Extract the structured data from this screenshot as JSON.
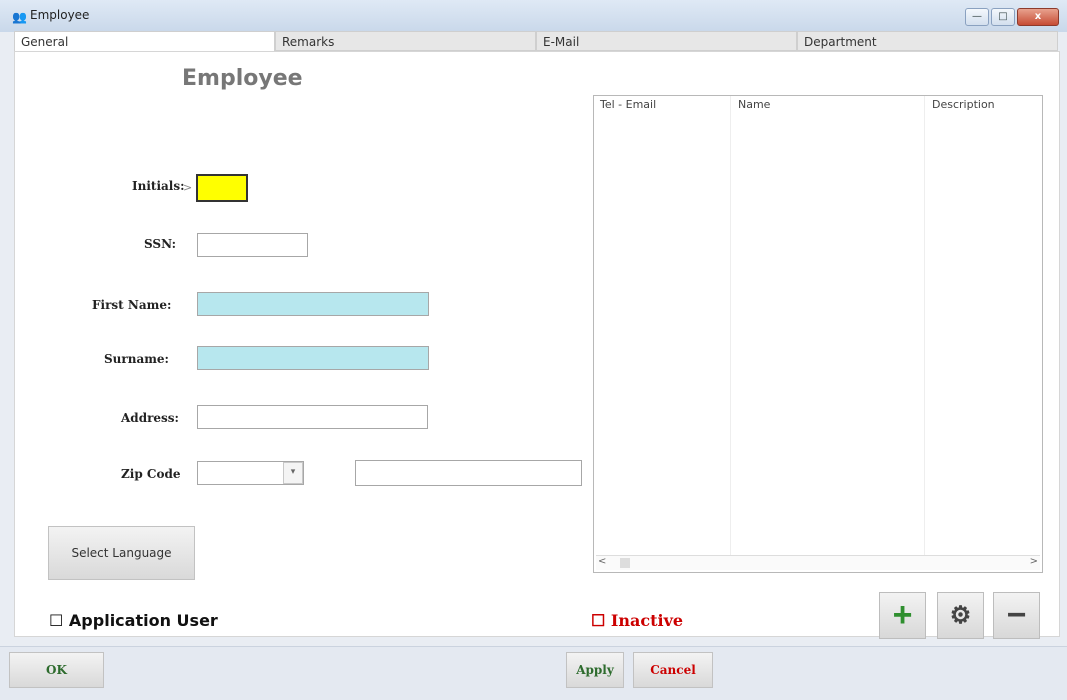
{
  "window": {
    "title": "Employee"
  },
  "tabs": [
    {
      "label": "General"
    },
    {
      "label": "Remarks"
    },
    {
      "label": "E-Mail"
    },
    {
      "label": "Department"
    }
  ],
  "form": {
    "heading": "Employee",
    "fields": {
      "initials": {
        "label": "Initials:",
        "arrow": ">"
      },
      "ssn": {
        "label": "SSN:"
      },
      "first_name": {
        "label": "First Name:"
      },
      "surname": {
        "label": "Surname:"
      },
      "address": {
        "label": "Address:"
      },
      "zip_code": {
        "label": "Zip Code"
      }
    },
    "select_language_button": "Select Language",
    "application_user_label": "Application User"
  },
  "contacts": {
    "columns": [
      "Tel - Email",
      "Name",
      "Description"
    ],
    "scroll_left": "<",
    "scroll_right": ">",
    "inactive_label": "Inactive"
  },
  "actions": {
    "plus_icon": "+",
    "gear_icon": "⚙",
    "minus_icon": "−"
  },
  "bottom": {
    "ok": "OK",
    "apply": "Apply",
    "cancel": "Cancel"
  },
  "colors": {
    "required_field": "#b7e7ee",
    "focus_field": "#ffff00",
    "inactive_text": "#cc0000",
    "plus_icon": "#2f8f2f"
  }
}
